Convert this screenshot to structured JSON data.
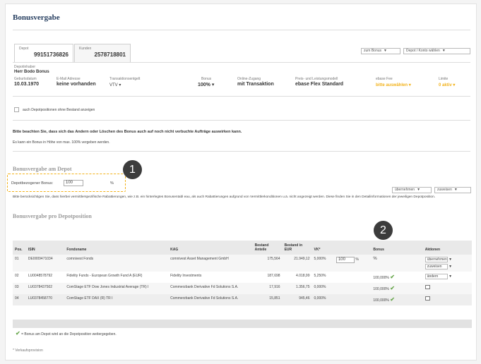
{
  "page": {
    "title": "Bonusvergabe"
  },
  "tabs": [
    {
      "label": "Depot",
      "number": "99151736826"
    },
    {
      "label": "Kunden",
      "number": "2578718801"
    }
  ],
  "top_selects": [
    {
      "label": "zum Bonus"
    },
    {
      "label": "Depot / Konto wählen"
    }
  ],
  "depot_holder": {
    "label": "Depotinhaber",
    "name": "Herr Bodo Bonus"
  },
  "info": [
    {
      "label": "Geburtsdatum",
      "value": "10.03.1970"
    },
    {
      "label": "E-Mail Adresse",
      "value": "keine vorhanden"
    },
    {
      "label": "Transaktionsentgelt",
      "value": "VTV"
    },
    {
      "label": "Bonus",
      "value": "100%"
    },
    {
      "label": "Online-Zugang",
      "value": "mit Transaktion"
    },
    {
      "label": "Preis- und Leistungsmodell",
      "value": "ebase Flex Standard"
    },
    {
      "label": "ebase Fee",
      "value": "bitte auswählen"
    },
    {
      "label": "Limite",
      "value": "0 aktiv"
    }
  ],
  "checkbox_label": "auch Depotpositionen ohne Bestand anzeigen",
  "warning": "Bitte beachten Sie, dass sich das Ändern oder Löschen des Bonus auch auf noch nicht verbuchte Aufträge auswirken kann.",
  "info_text": "Es kann ein Bonus in Höhe von max. 100% vergeben werden.",
  "depot_section": {
    "title": "Bonusvergabe am Depot",
    "field_label": "Depotbezogener Bonus:",
    "field_value": "100",
    "unit": "%",
    "btn_apply": "übernehmen",
    "btn_assign": "zuweisen",
    "note": "Bitte berücksichtigen Sie, dass hierbei vermittlerspezifische Rabattierungen, wie z.B. ein hinterlegtes Bonusentabl eau, als auch Rabattierungen aufgrund von Vermittlerkonditionen u.ä. nicht angezeigt werden. Diese finden Sie in den Detailinformationen der jeweiligen Depotposition."
  },
  "positions_section": {
    "title": "Bonusvergabe pro Depotposition"
  },
  "table": {
    "headers": [
      "Pos.",
      "ISIN",
      "Fondsname",
      "KAG",
      "Bestand Anteile",
      "Bestand in EUR",
      "VK*",
      "",
      "Bonus",
      "Aktionen"
    ],
    "rows": [
      {
        "pos": "01",
        "isin": "DE0009471034",
        "fund": "comnivest Fonds",
        "kag": "comnivest Asset Management GmbH",
        "shares": "175,564",
        "eur": "21.949,12",
        "vk": "5,000%",
        "input": "100",
        "unit": "%",
        "bonus": "",
        "action": "übernehmen",
        "action2": "zuweisen"
      },
      {
        "pos": "02",
        "isin": "LU0048578792",
        "fund": "Fidelity Funds - European Growth Fund A (EUR)",
        "kag": "Fidelity Investments",
        "shares": "187,698",
        "eur": "4.018,99",
        "vk": "5,250%",
        "input": "",
        "unit": "",
        "bonus": "100,000%",
        "action": "ändern",
        "action2": ""
      },
      {
        "pos": "03",
        "isin": "LU0378437502",
        "fund": "ComStage ETF Dow Jones Industrial Average (TR) I",
        "kag": "Commerzbank Derivative Fd Solutions S.A.",
        "shares": "17,916",
        "eur": "1.356,75",
        "vk": "0,000%",
        "input": "",
        "unit": "",
        "bonus": "100,000%",
        "action": "",
        "action2": ""
      },
      {
        "pos": "04",
        "isin": "LU0378458770",
        "fund": "ComStage ETF DAX (R) TR I",
        "kag": "Commerzbank Derivative Fd Solutions S.A.",
        "shares": "15,851",
        "eur": "945,46",
        "vk": "0,000%",
        "input": "",
        "unit": "",
        "bonus": "100,000%",
        "action": "",
        "action2": ""
      }
    ]
  },
  "legend": "= Bonus am Depot wird an die Depotposition weitergegeben.",
  "footnote": "* Verkaufsprovision",
  "badges": [
    "1",
    "2"
  ],
  "colors": {
    "accent": "#f2b118",
    "title": "#243c5e",
    "check": "#6aa84f"
  }
}
